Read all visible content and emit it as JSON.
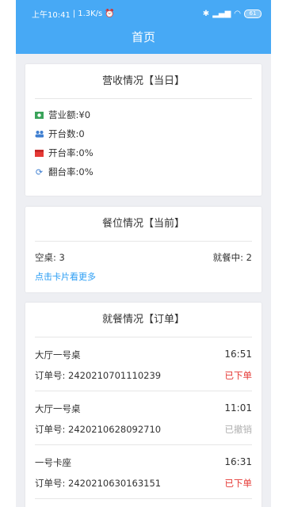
{
  "status_bar": {
    "time": "上午10:41",
    "speed": "1.3K/s",
    "battery": "61"
  },
  "header": {
    "title": "首页"
  },
  "revenue": {
    "title": "营收情况【当日】",
    "items": [
      {
        "icon": "money-icon",
        "label": "营业额",
        "value": "¥0"
      },
      {
        "icon": "people-icon",
        "label": "开台数",
        "value": "0"
      },
      {
        "icon": "gift-icon",
        "label": "开台率",
        "value": "0%"
      },
      {
        "icon": "refresh-icon",
        "label": "翻台率",
        "value": "0%"
      }
    ]
  },
  "seats": {
    "title": "餐位情况【当前】",
    "empty_label": "空桌",
    "empty_value": "3",
    "dining_label": "就餐中",
    "dining_value": "2",
    "more_link": "点击卡片看更多"
  },
  "orders": {
    "title": "就餐情况【订单】",
    "order_no_label": "订单号",
    "items": [
      {
        "table": "大厅一号桌",
        "time": "16:51",
        "order_no": "2420210701110239",
        "status": "已下单",
        "status_type": "red"
      },
      {
        "table": "大厅一号桌",
        "time": "11:01",
        "order_no": "2420210628092710",
        "status": "已撤销",
        "status_type": "gray"
      },
      {
        "table": "一号卡座",
        "time": "16:31",
        "order_no": "2420210630163151",
        "status": "已下单",
        "status_type": "red"
      }
    ]
  },
  "colors": {
    "header_bg": "#47a9f5",
    "accent_link": "#2a9df4",
    "status_red": "#e53935",
    "status_gray": "#b0b0b0"
  }
}
